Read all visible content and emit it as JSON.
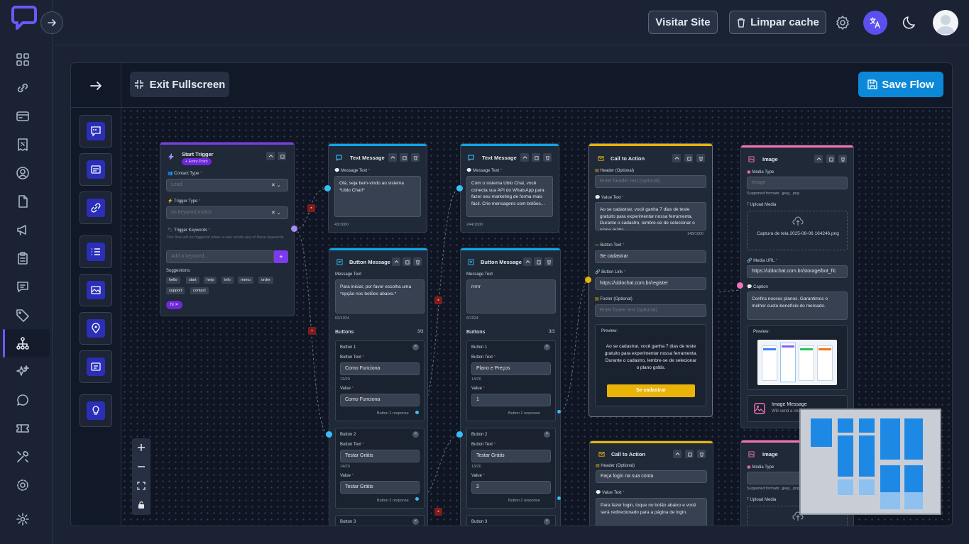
{
  "header": {
    "visit_site": "Visitar Site",
    "clear_cache": "Limpar cache"
  },
  "builder": {
    "exit_fullscreen": "Exit Fullscreen",
    "save_flow": "Save Flow"
  },
  "start_trigger": {
    "title": "Start Trigger",
    "badge": "+ Entry Point",
    "contact_type_label": "Contact Type",
    "contact_type_placeholder": "Lead",
    "trigger_type_label": "Trigger Type",
    "trigger_type_placeholder": "on keyword match",
    "keywords_label": "Trigger Keywords",
    "keywords_hint": "This flow will be triggered when a user sends any of these keywords",
    "keyword_placeholder": "Add a keyword...",
    "add_icon": "+",
    "suggestions_label": "Suggestions:",
    "suggestions": [
      "hello",
      "start",
      "help",
      "info",
      "menu",
      "order",
      "support",
      "contact"
    ],
    "selected_keyword": "hi"
  },
  "text_message_1": {
    "title": "Text Message",
    "label": "Message Text",
    "text": "Olá, seja bem-vindo ao sistema *Ublo Chat!*",
    "count": "43/1000"
  },
  "text_message_2": {
    "title": "Text Message",
    "label": "Message Text",
    "text": "Com o sistema Ublo Chat, você conecta sua API do WhatsApp para fazer seu marketing de forma mais fácil. Crie mensagens com botões...",
    "count": "244/1000"
  },
  "button_message_1": {
    "title": "Button Message",
    "label": "Message Text",
    "text": "Para iniciar, por favor escolha uma *opção nos botões abaixo.*",
    "count": "62/1024",
    "buttons_label": "Buttons",
    "buttons_count": "3/3",
    "buttons": [
      {
        "title": "Button 1",
        "text_label": "Button Text",
        "text": "Como Funciona",
        "text_count": "13/20",
        "value_label": "Value",
        "value": "Como Funciona",
        "response": "Button 1 response"
      },
      {
        "title": "Button 2",
        "text_label": "Button Text",
        "text": "Testar Grátis",
        "text_count": "14/20",
        "value_label": "Value",
        "value": "Testar Grátis",
        "response": "Button 2 response"
      },
      {
        "title": "Button 3"
      }
    ]
  },
  "button_message_2": {
    "title": "Button Message",
    "label": "Message Text",
    "text": "rrrrrr",
    "count": "6/1024",
    "buttons_label": "Buttons",
    "buttons_count": "3/3",
    "buttons": [
      {
        "title": "Button 1",
        "text_label": "Button Text",
        "text": "Plano e Preços",
        "text_count": "14/20",
        "value_label": "Value",
        "value": "1",
        "response": "Button 1 response"
      },
      {
        "title": "Button 2",
        "text_label": "Button Text",
        "text": "Testar Grátis",
        "text_count": "13/20",
        "value_label": "Value",
        "value": "2",
        "response": "Button 2 response"
      },
      {
        "title": "Button 3"
      }
    ]
  },
  "cta_1": {
    "title": "Call to Action",
    "header_label": "Header (Optional)",
    "header_placeholder": "Enter header text (optional)",
    "value_label": "Value Text",
    "value_text": "Ao se cadastrar, você ganha 7 dias de teste gratuito para experimentar nossa ferramenta. Durante o cadastro, lembre-se de selecionar o plano grátis.",
    "value_count": "148/1000",
    "button_text_label": "Button Text",
    "button_text": "Se cadastrar",
    "button_link_label": "Button Link",
    "button_link": "https://ublochat.com.br/register",
    "footer_label": "Footer (Optional)",
    "footer_placeholder": "Enter footer text (optional)",
    "preview_label": "Preview:",
    "preview_text": "Ao se cadastrar, você ganha 7 dias de teste gratuito para experimentar nossa ferramenta. Durante o cadastro, lembre-se de selecionar o plano grátis.",
    "preview_button": "Se cadastrar"
  },
  "cta_2": {
    "title": "Call to Action",
    "header_label": "Header (Optional)",
    "header_text": "Faça login na sua conta",
    "value_label": "Value Text",
    "value_text": "Para fazer login, toque no botão abaixo e você será redirecionado para a página de login."
  },
  "image_1": {
    "title": "Image",
    "media_type_label": "Media Type",
    "media_type_placeholder": "Image",
    "supported": "Supported formats: .jpeg, .png",
    "upload_label": "Upload Media",
    "file_name": "Captura de tela 2025-08-06 164246.png",
    "url_label": "Media URL",
    "url": "https://ublochat.com.br/storage/bot_flc",
    "caption_label": "Caption",
    "caption": "Confira nossos planos. Garantimos o melhor custo-benefício do mercado.",
    "preview_label": "Preview:",
    "footer_title": "Image Message",
    "footer_sub": "Will send a image"
  },
  "image_2": {
    "title": "Image",
    "media_type_label": "Media Type",
    "supported": "Supported formats: .jpeg, .png",
    "upload_label": "Upload Media"
  },
  "colors": {
    "accent": "#0b89d8",
    "brand": "#6b59f5",
    "cta": "#eab308",
    "image": "#f472b6",
    "text": "#0ea5e9",
    "trigger": "#7c3aed"
  }
}
